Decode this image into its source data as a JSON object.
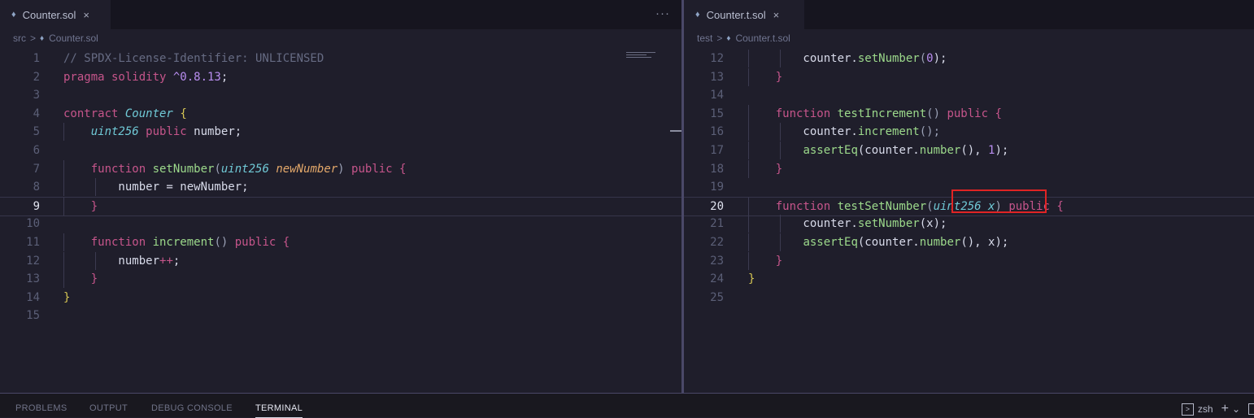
{
  "left": {
    "tab": {
      "label": "Counter.sol",
      "close": "×"
    },
    "more": "···",
    "breadcrumb": {
      "folder": "src",
      "sep": ">",
      "file": "Counter.sol"
    },
    "active_line": 9,
    "lines": [
      {
        "n": "1",
        "tokens": [
          [
            "// SPDX-License-Identifier: UNLICENSED",
            "comment"
          ]
        ]
      },
      {
        "n": "2",
        "tokens": [
          [
            "pragma solidity ",
            "kw"
          ],
          [
            "^0.8.13",
            "num"
          ],
          [
            ";",
            "var"
          ]
        ]
      },
      {
        "n": "3",
        "tokens": []
      },
      {
        "n": "4",
        "tokens": [
          [
            "contract ",
            "kw"
          ],
          [
            "Counter",
            "class"
          ],
          [
            " ",
            "var"
          ],
          [
            "{",
            "brace"
          ]
        ]
      },
      {
        "n": "5",
        "tokens": [
          [
            "    ",
            "var"
          ],
          [
            "uint256",
            "type"
          ],
          [
            " public ",
            "kw"
          ],
          [
            "number;",
            "var"
          ]
        ]
      },
      {
        "n": "6",
        "tokens": []
      },
      {
        "n": "7",
        "tokens": [
          [
            "    ",
            "var"
          ],
          [
            "function ",
            "kw"
          ],
          [
            "setNumber",
            "fn"
          ],
          [
            "(",
            "punc"
          ],
          [
            "uint256 ",
            "type"
          ],
          [
            "newNumber",
            "param"
          ],
          [
            ") ",
            "punc"
          ],
          [
            "public ",
            "kw"
          ],
          [
            "{",
            "brace2"
          ]
        ]
      },
      {
        "n": "8",
        "tokens": [
          [
            "        number = newNumber;",
            "var"
          ]
        ]
      },
      {
        "n": "9",
        "tokens": [
          [
            "    ",
            "var"
          ],
          [
            "}",
            "brace2"
          ]
        ]
      },
      {
        "n": "10",
        "tokens": []
      },
      {
        "n": "11",
        "tokens": [
          [
            "    ",
            "var"
          ],
          [
            "function ",
            "kw"
          ],
          [
            "increment",
            "fn"
          ],
          [
            "() ",
            "punc"
          ],
          [
            "public ",
            "kw"
          ],
          [
            "{",
            "brace2"
          ]
        ]
      },
      {
        "n": "12",
        "tokens": [
          [
            "        number",
            "var"
          ],
          [
            "++",
            "op"
          ],
          [
            ";",
            "var"
          ]
        ]
      },
      {
        "n": "13",
        "tokens": [
          [
            "    ",
            "var"
          ],
          [
            "}",
            "brace2"
          ]
        ]
      },
      {
        "n": "14",
        "tokens": [
          [
            "}",
            "brace"
          ]
        ]
      },
      {
        "n": "15",
        "tokens": []
      }
    ]
  },
  "right": {
    "tab": {
      "label": "Counter.t.sol",
      "close": "×"
    },
    "breadcrumb": {
      "folder": "test",
      "sep": ">",
      "file": "Counter.t.sol"
    },
    "active_line": 20,
    "lines": [
      {
        "n": "12",
        "tokens": [
          [
            "        counter.",
            "var"
          ],
          [
            "setNumber",
            "fn"
          ],
          [
            "(",
            "punc"
          ],
          [
            "0",
            "num"
          ],
          [
            ");",
            "var"
          ]
        ]
      },
      {
        "n": "13",
        "tokens": [
          [
            "    ",
            "var"
          ],
          [
            "}",
            "brace2"
          ]
        ]
      },
      {
        "n": "14",
        "tokens": []
      },
      {
        "n": "15",
        "tokens": [
          [
            "    ",
            "var"
          ],
          [
            "function ",
            "kw"
          ],
          [
            "testIncrement",
            "fn"
          ],
          [
            "() ",
            "punc"
          ],
          [
            "public ",
            "kw"
          ],
          [
            "{",
            "brace2"
          ]
        ]
      },
      {
        "n": "16",
        "tokens": [
          [
            "        counter.",
            "var"
          ],
          [
            "increment",
            "fn"
          ],
          [
            "();",
            "punc"
          ]
        ]
      },
      {
        "n": "17",
        "tokens": [
          [
            "        ",
            "var"
          ],
          [
            "assertEq",
            "fn"
          ],
          [
            "(counter.",
            "var"
          ],
          [
            "number",
            "fn"
          ],
          [
            "(), ",
            "var"
          ],
          [
            "1",
            "num"
          ],
          [
            ");",
            "var"
          ]
        ]
      },
      {
        "n": "18",
        "tokens": [
          [
            "    ",
            "var"
          ],
          [
            "}",
            "brace2"
          ]
        ]
      },
      {
        "n": "19",
        "tokens": []
      },
      {
        "n": "20",
        "tokens": [
          [
            "    ",
            "var"
          ],
          [
            "function ",
            "kw"
          ],
          [
            "testSetNumber",
            "fn"
          ],
          [
            "(",
            "punc"
          ],
          [
            "uint256 x",
            "type"
          ],
          [
            ") ",
            "punc"
          ],
          [
            "public ",
            "kw"
          ],
          [
            "{",
            "brace2"
          ]
        ]
      },
      {
        "n": "21",
        "tokens": [
          [
            "        counter.",
            "var"
          ],
          [
            "setNumber",
            "fn"
          ],
          [
            "(x);",
            "var"
          ]
        ]
      },
      {
        "n": "22",
        "tokens": [
          [
            "        ",
            "var"
          ],
          [
            "assertEq",
            "fn"
          ],
          [
            "(counter.",
            "var"
          ],
          [
            "number",
            "fn"
          ],
          [
            "(), x);",
            "var"
          ]
        ]
      },
      {
        "n": "23",
        "tokens": [
          [
            "    ",
            "var"
          ],
          [
            "}",
            "brace2"
          ]
        ]
      },
      {
        "n": "24",
        "tokens": [
          [
            "}",
            "brace"
          ]
        ]
      },
      {
        "n": "25",
        "tokens": []
      }
    ]
  },
  "panel": {
    "tabs": [
      {
        "label": "PROBLEMS",
        "active": false
      },
      {
        "label": "OUTPUT",
        "active": false
      },
      {
        "label": "DEBUG CONSOLE",
        "active": false
      },
      {
        "label": "TERMINAL",
        "active": true
      }
    ],
    "terminal_shell": "zsh",
    "add_label": "+",
    "dropdown_label": "⌄"
  },
  "colors": {
    "keyword": "#c6558b",
    "type": "#70c9d6",
    "function": "#9cd98b",
    "number": "#b98ef0",
    "param": "#e3a86a",
    "highlight_box": "#e02424"
  },
  "icons": [
    "solidity-file-icon",
    "close-icon",
    "more-actions-icon",
    "terminal-icon",
    "add-terminal-icon",
    "chevron-down-icon"
  ]
}
